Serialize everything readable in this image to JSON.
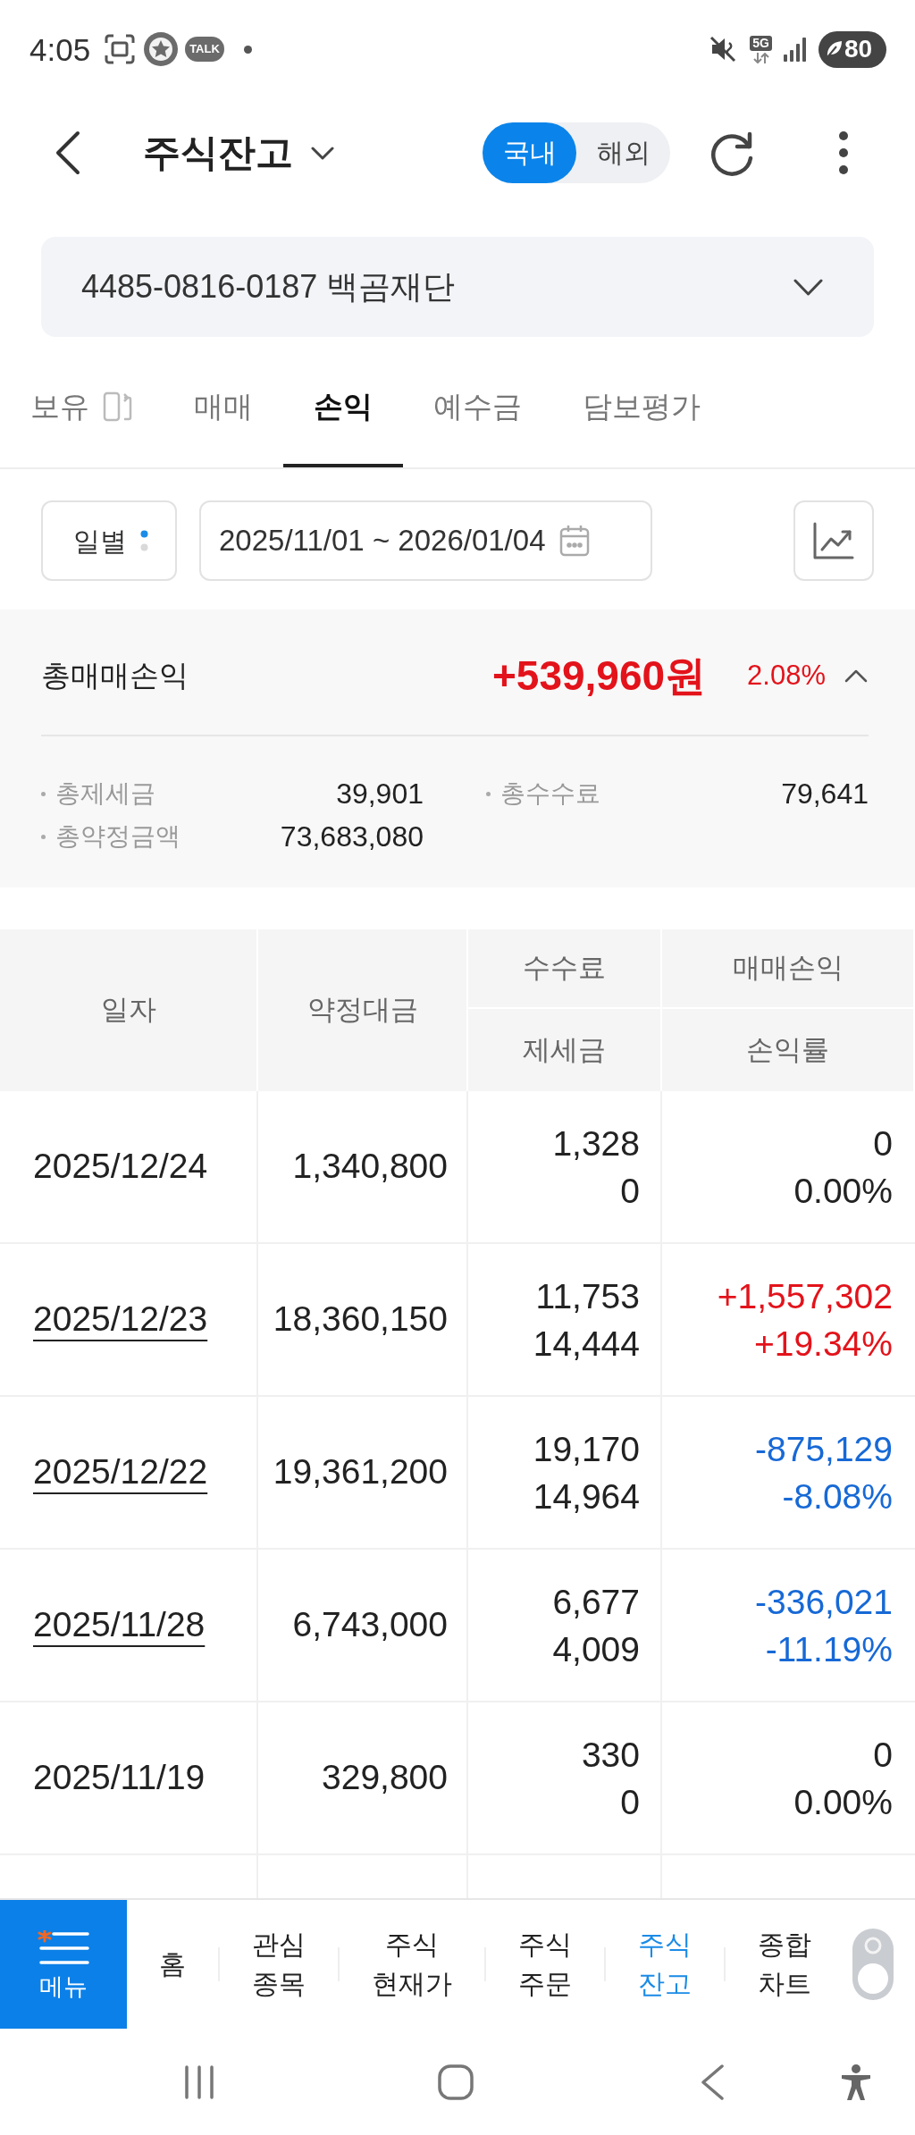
{
  "status_bar": {
    "time": "4:05",
    "chat_badge": "TALK",
    "network": "5G",
    "battery": "80"
  },
  "header": {
    "title": "주식잔고",
    "market_toggle": [
      {
        "label": "국내",
        "selected": true
      },
      {
        "label": "해외",
        "selected": false
      }
    ]
  },
  "account_select": {
    "value": "4485-0816-0187 백곰재단"
  },
  "tabs": [
    {
      "label": "보유",
      "kind": "with_icon",
      "selected": false
    },
    {
      "label": "매매",
      "kind": "plain",
      "selected": false
    },
    {
      "label": "손익",
      "kind": "plain",
      "selected": true
    },
    {
      "label": "예수금",
      "kind": "plain",
      "selected": false
    },
    {
      "label": "담보평가",
      "kind": "plain",
      "selected": false
    }
  ],
  "filter": {
    "period": "일별",
    "date_range": "2025/11/01 ~ 2026/01/04"
  },
  "summary": {
    "label": "총매매손익",
    "value": "+539,960원",
    "rate": "2.08%",
    "color": "#e3131b",
    "expanded": true,
    "details": [
      {
        "label": "총제세금",
        "value": "39,901"
      },
      {
        "label": "총수수료",
        "value": "79,641"
      },
      {
        "label": "총약정금액",
        "value": "73,683,080"
      }
    ]
  },
  "table": {
    "columns": [
      {
        "label": "일자"
      },
      {
        "label": "약정대금"
      },
      {
        "label": "수수료",
        "sub_label": "제세금"
      },
      {
        "label": "매매손익",
        "sub_label": "손익률"
      }
    ],
    "rows": [
      {
        "date": "2025/12/24",
        "linked": false,
        "amount": "1,340,800",
        "fee": "1,328",
        "tax": "0",
        "profit": "0",
        "rate": "0.00%",
        "color": "#222222"
      },
      {
        "date": "2025/12/23",
        "linked": true,
        "amount": "18,360,150",
        "fee": "11,753",
        "tax": "14,444",
        "profit": "+1,557,302",
        "rate": "+19.34%",
        "color": "#e3131b"
      },
      {
        "date": "2025/12/22",
        "linked": true,
        "amount": "19,361,200",
        "fee": "19,170",
        "tax": "14,964",
        "profit": "-875,129",
        "rate": "-8.08%",
        "color": "#1769d6"
      },
      {
        "date": "2025/11/28",
        "linked": true,
        "amount": "6,743,000",
        "fee": "6,677",
        "tax": "4,009",
        "profit": "-336,021",
        "rate": "-11.19%",
        "color": "#1769d6"
      },
      {
        "date": "2025/11/19",
        "linked": false,
        "amount": "329,800",
        "fee": "330",
        "tax": "0",
        "profit": "0",
        "rate": "0.00%",
        "color": "#222222"
      }
    ]
  },
  "bottom_nav": {
    "menu_label": "메뉴",
    "items": [
      {
        "label": "홈",
        "selected": false
      },
      {
        "label": "관심\n종목",
        "selected": false
      },
      {
        "label": "주식\n현재가",
        "selected": false
      },
      {
        "label": "주식\n주문",
        "selected": false
      },
      {
        "label": "주식\n잔고",
        "selected": true
      },
      {
        "label": "종합\n차트",
        "selected": false
      }
    ]
  }
}
